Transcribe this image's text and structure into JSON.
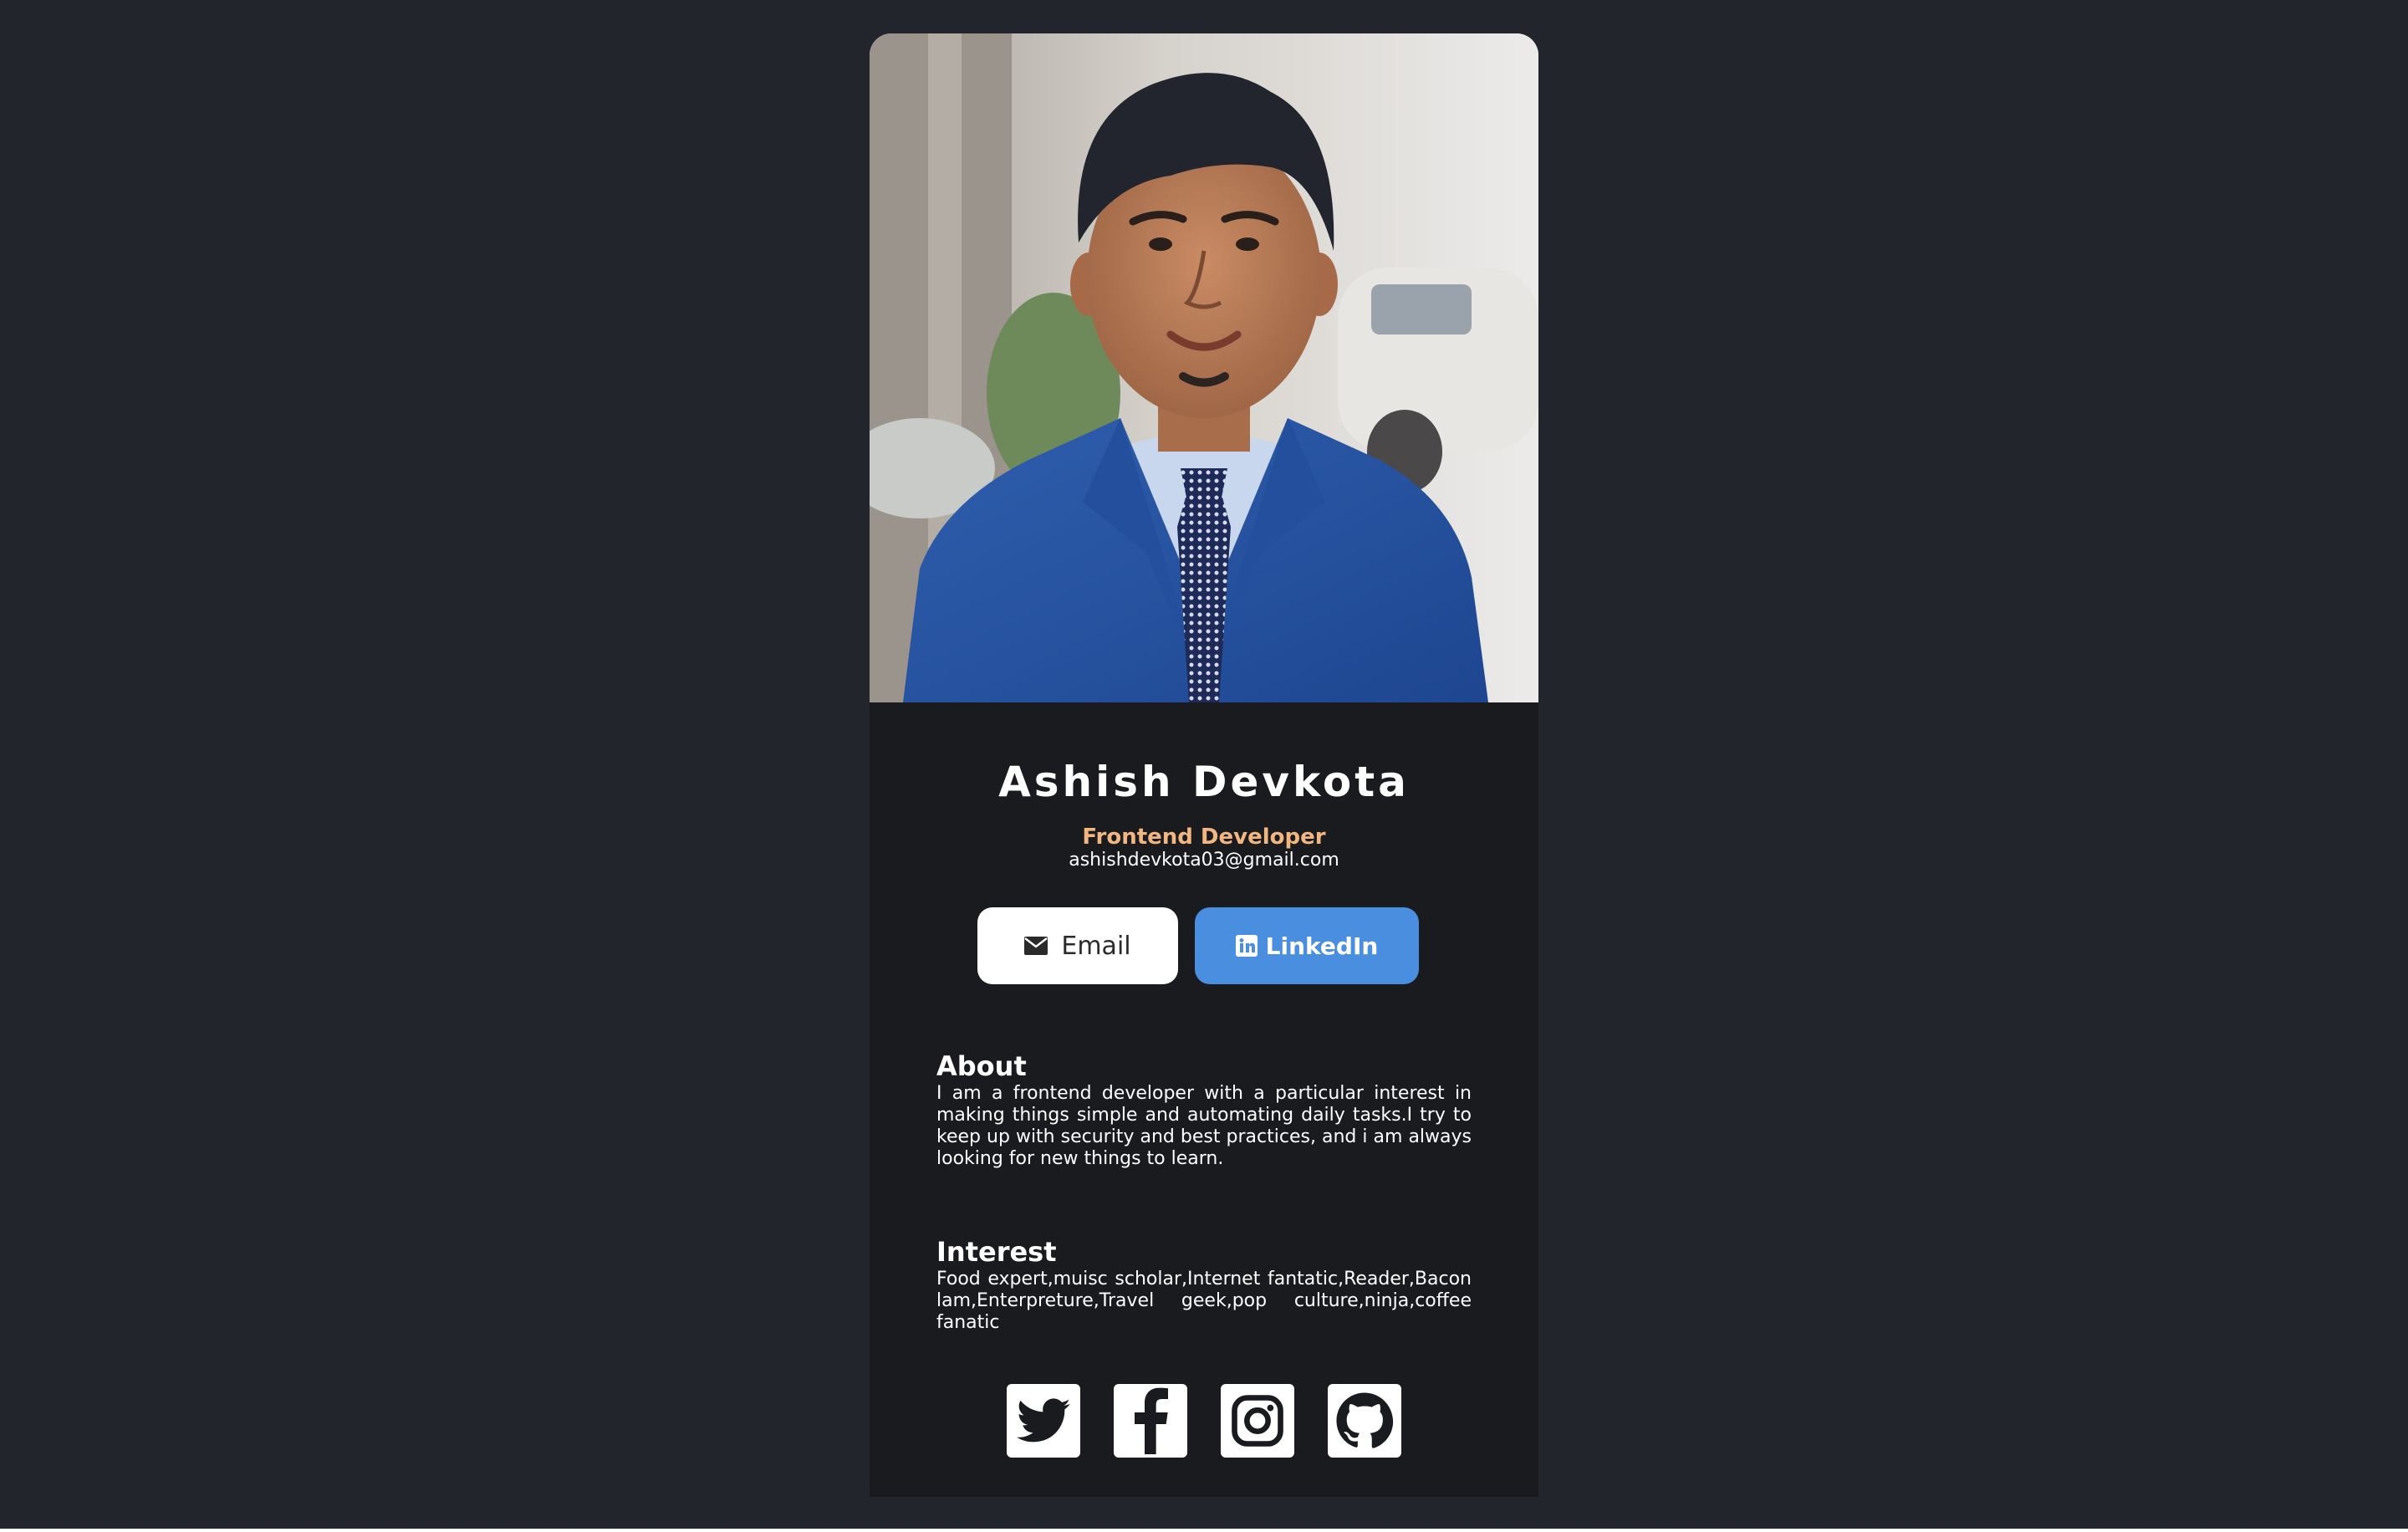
{
  "profile": {
    "name": "Ashish Devkota",
    "role": "Frontend Developer",
    "email": "ashishdevkota03@gmail.com"
  },
  "buttons": {
    "email_label": "Email",
    "email_icon": "envelope-icon",
    "linkedin_label": "LinkedIn",
    "linkedin_icon": "linkedin-icon"
  },
  "about": {
    "title": "About",
    "body": "I am a frontend developer with a particular interest in making things simple and automating daily tasks.I try to keep up with security and best practices, and i am always looking for new things to learn."
  },
  "interest": {
    "title": "Interest",
    "body": "Food expert,muisc scholar,Internet fantatic,Reader,Bacon lam,Enterpreture,Travel geek,pop culture,ninja,coffee fanatic"
  },
  "socials": [
    "twitter-icon",
    "facebook-icon",
    "instagram-icon",
    "github-icon"
  ],
  "colors": {
    "page_bg": "#23252c",
    "card_bg": "#1a1b1f",
    "role_accent": "#f2b680",
    "linkedin_blue": "#4a8ee0"
  }
}
